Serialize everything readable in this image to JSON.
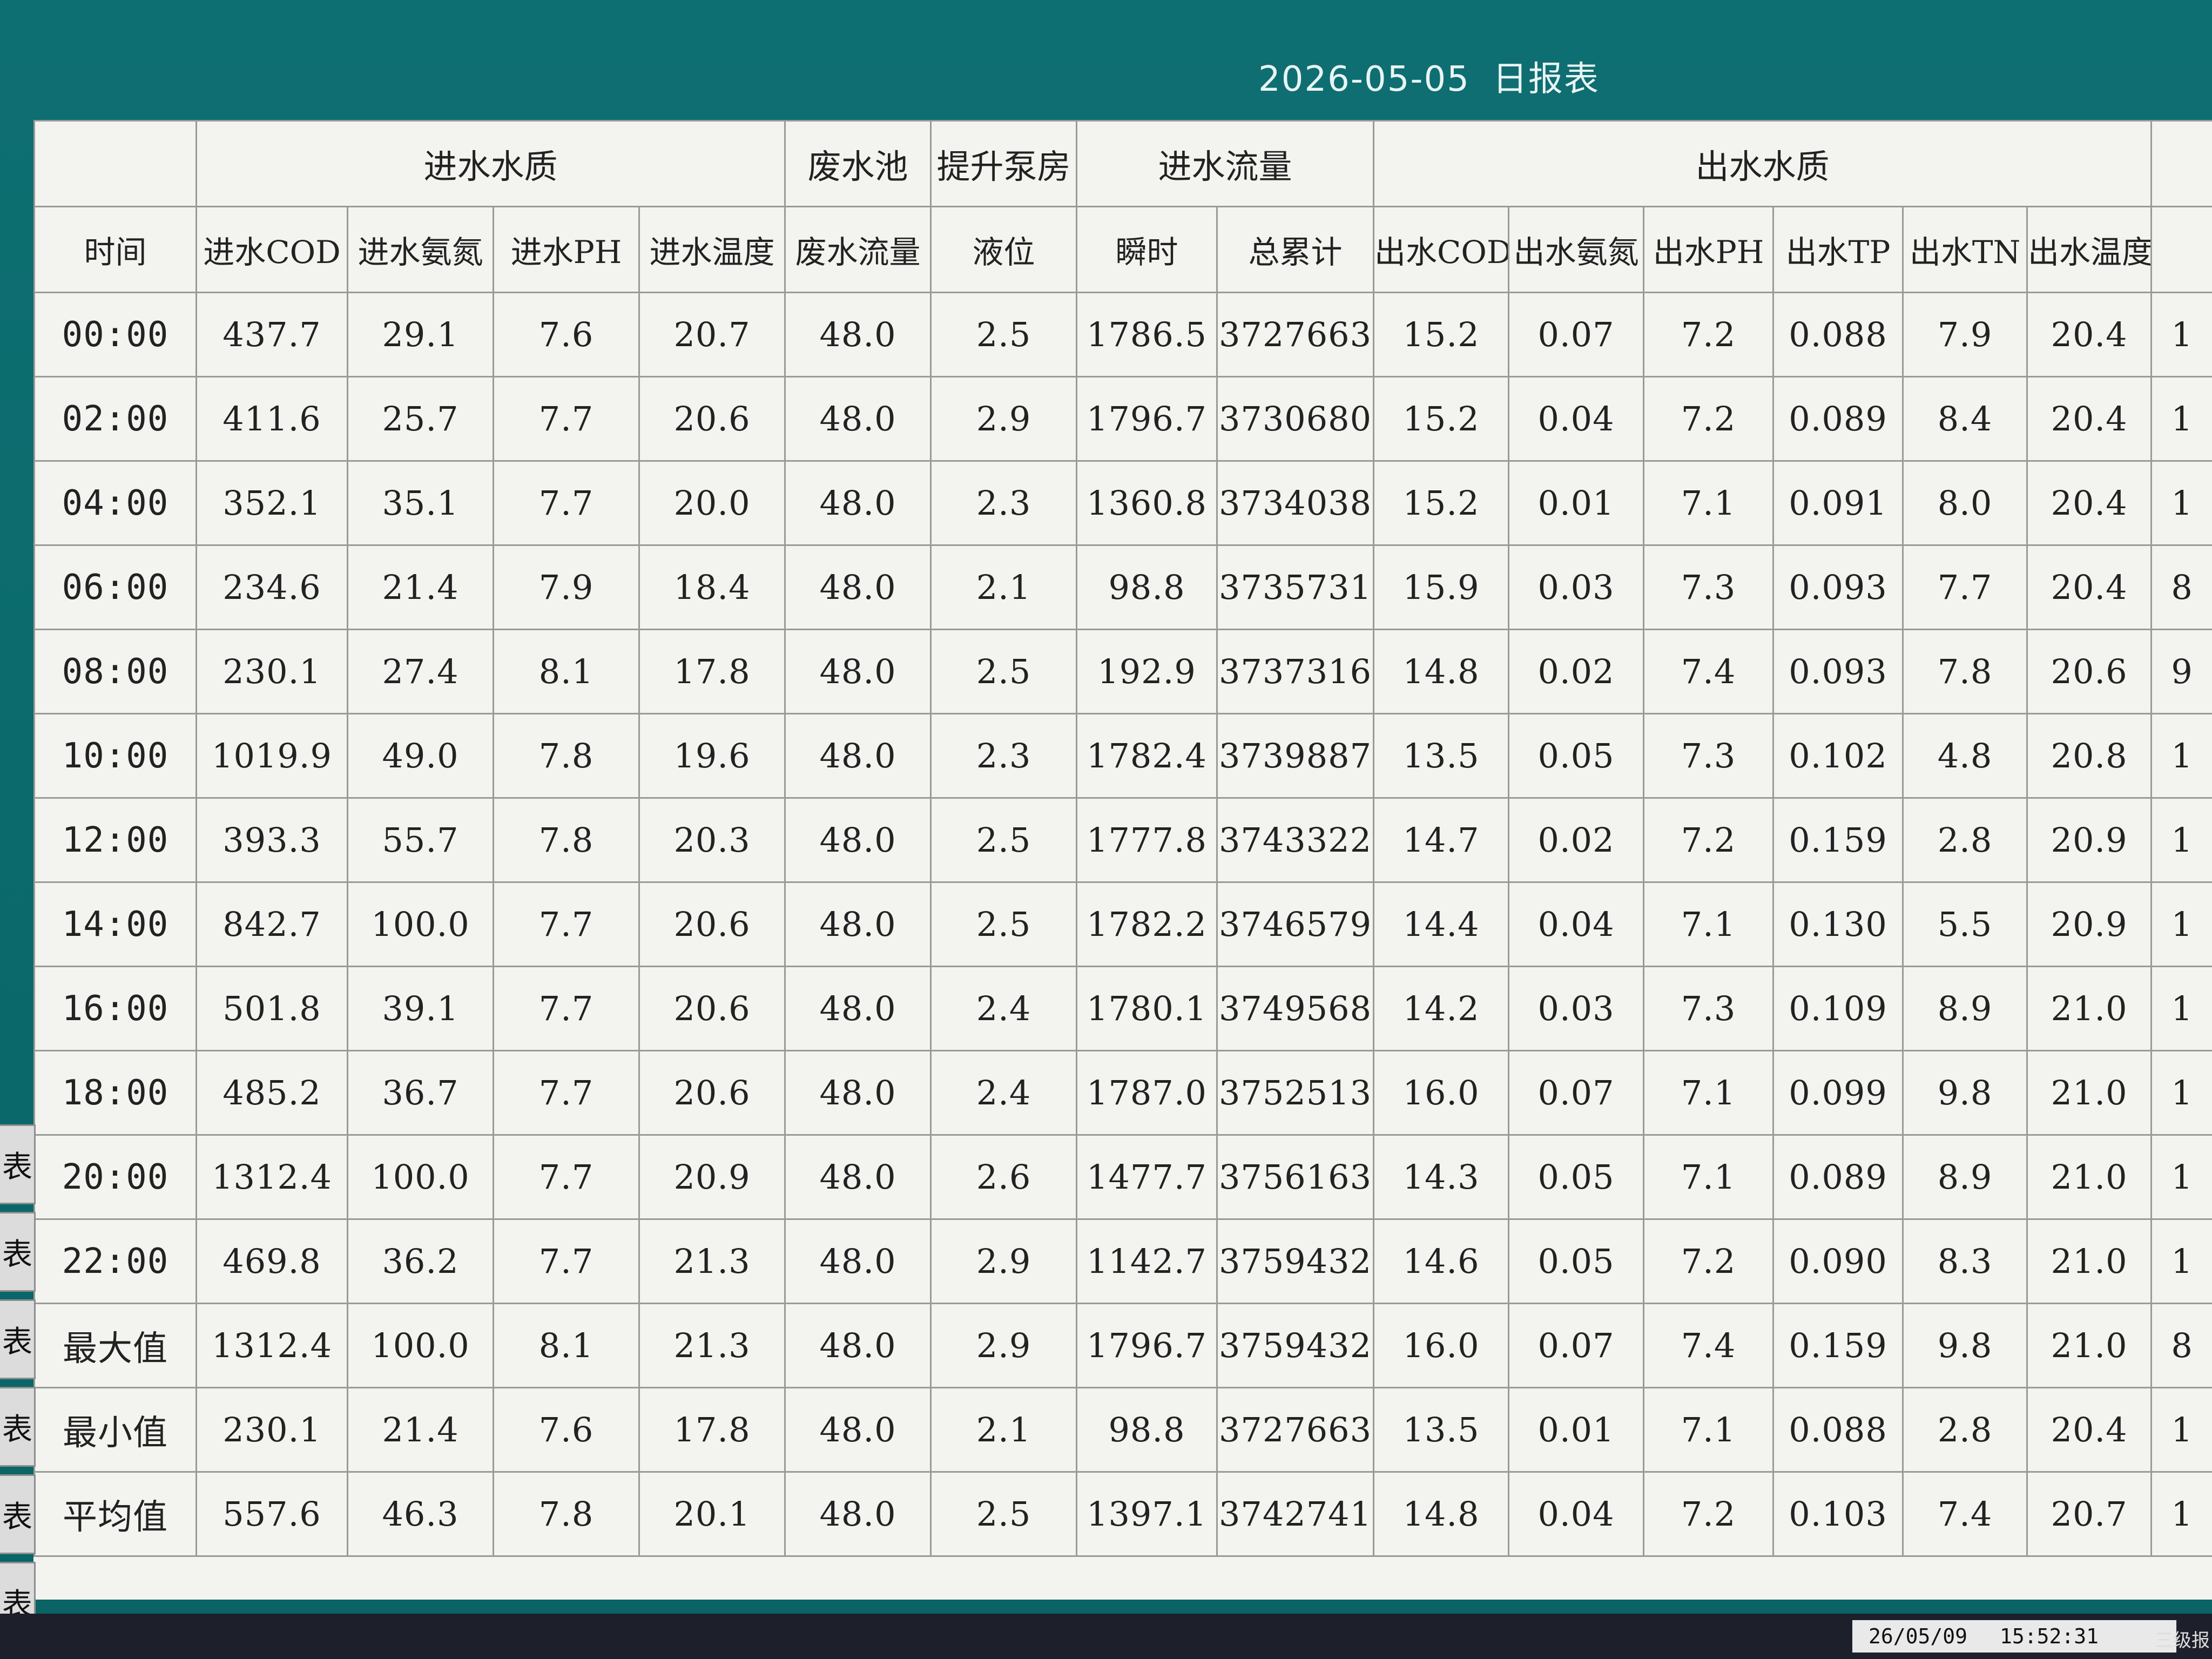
{
  "title": {
    "date": "2026-05-05",
    "name": "日报表"
  },
  "header": {
    "group_row": [
      {
        "label": "",
        "span": 1
      },
      {
        "label": "进水水质",
        "span": 4
      },
      {
        "label": "废水池",
        "span": 1
      },
      {
        "label": "提升泵房",
        "span": 1
      },
      {
        "label": "进水流量",
        "span": 2
      },
      {
        "label": "出水水质",
        "span": 6
      },
      {
        "label": "",
        "span": 1
      }
    ],
    "columns": [
      "时间",
      "进水COD",
      "进水氨氮",
      "进水PH",
      "进水温度",
      "废水流量",
      "液位",
      "瞬时",
      "总累计",
      "出水COD",
      "出水氨氮",
      "出水PH",
      "出水TP",
      "出水TN",
      "出水温度",
      ""
    ]
  },
  "rows": [
    [
      "00:00",
      "437.7",
      "29.1",
      "7.6",
      "20.7",
      "48.0",
      "2.5",
      "1786.5",
      "3727663",
      "15.2",
      "0.07",
      "7.2",
      "0.088",
      "7.9",
      "20.4",
      "1"
    ],
    [
      "02:00",
      "411.6",
      "25.7",
      "7.7",
      "20.6",
      "48.0",
      "2.9",
      "1796.7",
      "3730680",
      "15.2",
      "0.04",
      "7.2",
      "0.089",
      "8.4",
      "20.4",
      "1"
    ],
    [
      "04:00",
      "352.1",
      "35.1",
      "7.7",
      "20.0",
      "48.0",
      "2.3",
      "1360.8",
      "3734038",
      "15.2",
      "0.01",
      "7.1",
      "0.091",
      "8.0",
      "20.4",
      "1"
    ],
    [
      "06:00",
      "234.6",
      "21.4",
      "7.9",
      "18.4",
      "48.0",
      "2.1",
      "98.8",
      "3735731",
      "15.9",
      "0.03",
      "7.3",
      "0.093",
      "7.7",
      "20.4",
      "8"
    ],
    [
      "08:00",
      "230.1",
      "27.4",
      "8.1",
      "17.8",
      "48.0",
      "2.5",
      "192.9",
      "3737316",
      "14.8",
      "0.02",
      "7.4",
      "0.093",
      "7.8",
      "20.6",
      "9"
    ],
    [
      "10:00",
      "1019.9",
      "49.0",
      "7.8",
      "19.6",
      "48.0",
      "2.3",
      "1782.4",
      "3739887",
      "13.5",
      "0.05",
      "7.3",
      "0.102",
      "4.8",
      "20.8",
      "1"
    ],
    [
      "12:00",
      "393.3",
      "55.7",
      "7.8",
      "20.3",
      "48.0",
      "2.5",
      "1777.8",
      "3743322",
      "14.7",
      "0.02",
      "7.2",
      "0.159",
      "2.8",
      "20.9",
      "1"
    ],
    [
      "14:00",
      "842.7",
      "100.0",
      "7.7",
      "20.6",
      "48.0",
      "2.5",
      "1782.2",
      "3746579",
      "14.4",
      "0.04",
      "7.1",
      "0.130",
      "5.5",
      "20.9",
      "1"
    ],
    [
      "16:00",
      "501.8",
      "39.1",
      "7.7",
      "20.6",
      "48.0",
      "2.4",
      "1780.1",
      "3749568",
      "14.2",
      "0.03",
      "7.3",
      "0.109",
      "8.9",
      "21.0",
      "1"
    ],
    [
      "18:00",
      "485.2",
      "36.7",
      "7.7",
      "20.6",
      "48.0",
      "2.4",
      "1787.0",
      "3752513",
      "16.0",
      "0.07",
      "7.1",
      "0.099",
      "9.8",
      "21.0",
      "1"
    ],
    [
      "20:00",
      "1312.4",
      "100.0",
      "7.7",
      "20.9",
      "48.0",
      "2.6",
      "1477.7",
      "3756163",
      "14.3",
      "0.05",
      "7.1",
      "0.089",
      "8.9",
      "21.0",
      "1"
    ],
    [
      "22:00",
      "469.8",
      "36.2",
      "7.7",
      "21.3",
      "48.0",
      "2.9",
      "1142.7",
      "3759432",
      "14.6",
      "0.05",
      "7.2",
      "0.090",
      "8.3",
      "21.0",
      "1"
    ],
    [
      "最大值",
      "1312.4",
      "100.0",
      "8.1",
      "21.3",
      "48.0",
      "2.9",
      "1796.7",
      "3759432",
      "16.0",
      "0.07",
      "7.4",
      "0.159",
      "9.8",
      "21.0",
      "8"
    ],
    [
      "最小值",
      "230.1",
      "21.4",
      "7.6",
      "17.8",
      "48.0",
      "2.1",
      "98.8",
      "3727663",
      "13.5",
      "0.01",
      "7.1",
      "0.088",
      "2.8",
      "20.4",
      "1"
    ],
    [
      "平均值",
      "557.6",
      "46.3",
      "7.8",
      "20.1",
      "48.0",
      "2.5",
      "1397.1",
      "3742741",
      "14.8",
      "0.04",
      "7.2",
      "0.103",
      "7.4",
      "20.7",
      "1"
    ]
  ],
  "side_tabs": [
    "表",
    "表",
    "表",
    "表",
    "表",
    "表"
  ],
  "taskbar": {
    "date": "26/05/09",
    "time": "15:52:31",
    "status": "三级报"
  }
}
